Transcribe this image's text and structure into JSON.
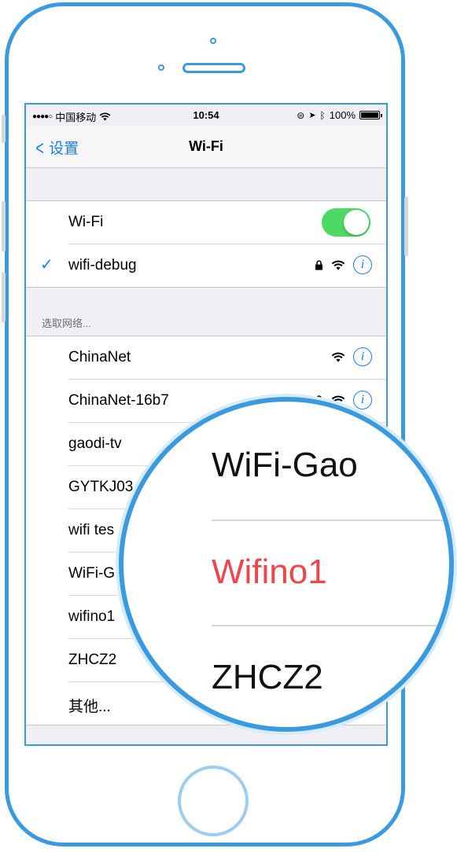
{
  "status_bar": {
    "signal_dots": "●●●●○",
    "carrier": "中国移动",
    "time": "10:54",
    "battery": "100%"
  },
  "nav": {
    "back_label": "设置",
    "title": "Wi-Fi"
  },
  "wifi_toggle": {
    "label": "Wi-Fi",
    "on": true
  },
  "connected": {
    "name": "wifi-debug",
    "locked": true
  },
  "section_header": "选取网络...",
  "networks": [
    {
      "name": "ChinaNet",
      "locked": false
    },
    {
      "name": "ChinaNet-16b7",
      "locked": true
    },
    {
      "name": "gaodi-tv"
    },
    {
      "name": "GYTKJ03"
    },
    {
      "name": "wifi tes"
    },
    {
      "name": "WiFi-G"
    },
    {
      "name": "wifino1"
    },
    {
      "name": "ZHCZ2"
    },
    {
      "name": "其他..."
    }
  ],
  "magnifier": {
    "items": [
      "WiFi-Gao",
      "Wifino1",
      "ZHCZ2"
    ],
    "highlight_color": "#f0454a"
  },
  "colors": {
    "accent": "#1a7cf0",
    "frame": "#3a9ae0",
    "toggle_on": "#4cd964"
  },
  "icons": {
    "info": "i"
  }
}
